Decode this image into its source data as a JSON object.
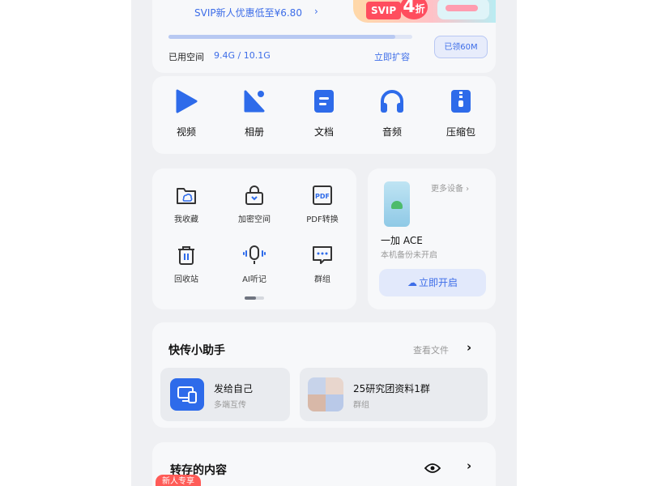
{
  "promo": {
    "text": "SVIP新人优惠低至¥6.80",
    "arrow": "›"
  },
  "banner": {
    "tag": "SVIP",
    "discount": "4",
    "discount_unit": "折"
  },
  "storage": {
    "used_label": "已用空间",
    "used_value": "9.4G / 10.1G",
    "used_fraction": 0.93,
    "expand_link": "立即扩容",
    "expand_button": "已领60M"
  },
  "categories": [
    {
      "label": "视频",
      "icon": "play-icon"
    },
    {
      "label": "相册",
      "icon": "image-icon"
    },
    {
      "label": "文档",
      "icon": "document-icon"
    },
    {
      "label": "音频",
      "icon": "headphones-icon"
    },
    {
      "label": "压缩包",
      "icon": "zip-icon"
    }
  ],
  "tools": [
    {
      "label": "我收藏",
      "icon": "folder-star-icon"
    },
    {
      "label": "加密空间",
      "icon": "lock-folder-icon"
    },
    {
      "label": "PDF转换",
      "icon": "pdf-icon"
    },
    {
      "label": "回收站",
      "icon": "trash-icon"
    },
    {
      "label": "AI听记",
      "icon": "microphone-icon"
    },
    {
      "label": "群组",
      "icon": "chat-icon"
    }
  ],
  "device": {
    "more": "更多设备 ›",
    "name": "一加 ACE",
    "status": "本机备份未开启",
    "button": "立即开启"
  },
  "quick_transfer": {
    "title": "快传小助手",
    "link": "查看文件",
    "chevron": "›",
    "items": [
      {
        "name": "发给自己",
        "sub": "多端互传",
        "icon": "monitor-phone-icon"
      },
      {
        "name": "25研究团资料1群",
        "sub": "群组",
        "icon": "group-thumbnails"
      }
    ]
  },
  "recent": {
    "title": "转存的内容",
    "chevron": "›",
    "badge": "新人专享"
  },
  "colors": {
    "accent": "#2e6bea",
    "link": "#3d6de8",
    "badge": "#ff5b57"
  }
}
